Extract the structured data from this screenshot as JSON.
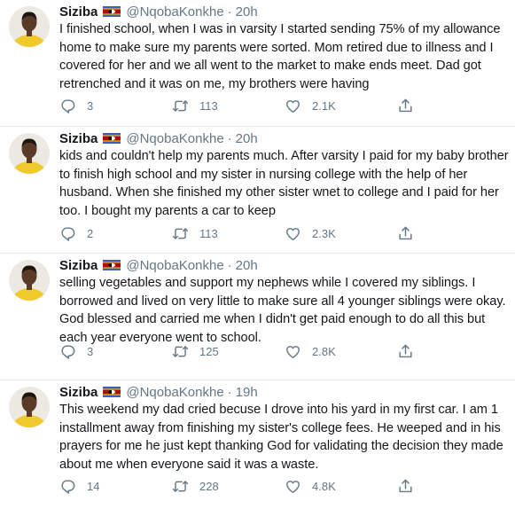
{
  "tweets": [
    {
      "name": "Siziba",
      "handle": "@NqobaKonkhe",
      "separator": "·",
      "time": "20h",
      "text": "I finished school, when I was in varsity I started sending 75% of my allowance home to make sure my parents were sorted. Mom retired due to illness and I covered for her and we all went to the market to make ends meet. Dad got retrenched and it was on me, my brothers were having",
      "replies": "3",
      "retweets": "113",
      "likes": "2.1K"
    },
    {
      "name": "Siziba",
      "handle": "@NqobaKonkhe",
      "separator": "·",
      "time": "20h",
      "text": "kids and couldn't help my parents much. After varsity I paid for my baby brother to finish high school and my sister in nursing college with the help of her husband. When she finished my other sister wnet to college and I paid for her too. I bought my parents a car to keep",
      "replies": "2",
      "retweets": "113",
      "likes": "2.3K"
    },
    {
      "name": "Siziba",
      "handle": "@NqobaKonkhe",
      "separator": "·",
      "time": "20h",
      "text": "selling vegetables and support my nephews while I covered my siblings. I borrowed and lived on very little to make sure all 4 younger siblings were okay. God blessed and carried me when I didn't get paid enough to do all this but each year everyone went to school.",
      "replies": "3",
      "retweets": "125",
      "likes": "2.8K"
    },
    {
      "name": "Siziba",
      "handle": "@NqobaKonkhe",
      "separator": "·",
      "time": "19h",
      "text": "This weekend my dad cried becuse I drove into his yard in my first car. I am 1 installment away from finishing my sister's college fees. He weeped and in his prayers for me he just kept thanking God for validating the decision they made about me when everyone said it was a waste.",
      "replies": "14",
      "retweets": "228",
      "likes": "4.8K"
    }
  ],
  "icons": {
    "reply": "reply-icon",
    "retweet": "retweet-icon",
    "like": "heart-icon",
    "share": "share-icon",
    "flag": "eswatini-flag-icon"
  },
  "colors": {
    "name": "#14171a",
    "muted": "#657786",
    "divider": "#e6ecf0",
    "flag_blue": "#3e5eb9",
    "flag_yellow": "#ffd900",
    "flag_red": "#b10c0c"
  }
}
